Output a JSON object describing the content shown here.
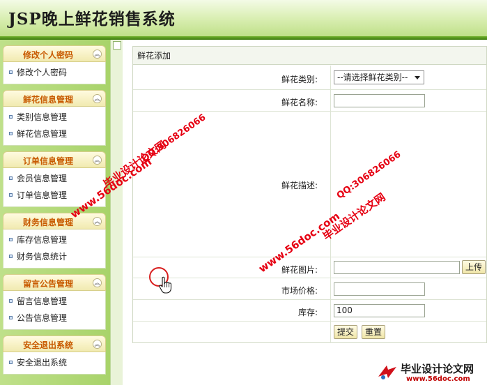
{
  "header": {
    "title": "JSP晚上鲜花销售系统"
  },
  "sidebar": {
    "groups": [
      {
        "title": "修改个人密码",
        "items": [
          "修改个人密码"
        ]
      },
      {
        "title": "鲜花信息管理",
        "items": [
          "类别信息管理",
          "鲜花信息管理"
        ]
      },
      {
        "title": "订单信息管理",
        "items": [
          "会员信息管理",
          "订单信息管理"
        ]
      },
      {
        "title": "财务信息管理",
        "items": [
          "库存信息管理",
          "财务信息统计"
        ]
      },
      {
        "title": "留言公告管理",
        "items": [
          "留言信息管理",
          "公告信息管理"
        ]
      },
      {
        "title": "安全退出系统",
        "items": [
          "安全退出系统"
        ]
      }
    ],
    "toggle_glyph": "︽"
  },
  "form": {
    "title": "鲜花添加",
    "category_label": "鲜花类别:",
    "category_selected": "--请选择鲜花类别--",
    "name_label": "鲜花名称:",
    "name_value": "",
    "desc_label": "鲜花描述:",
    "image_label": "鲜花图片:",
    "image_value": "",
    "upload_label": "上传",
    "price_label": "市场价格:",
    "price_value": "",
    "stock_label": "库存:",
    "stock_value": "100",
    "submit_label": "提交",
    "reset_label": "重置"
  },
  "watermarks": {
    "site": "www.56doc.com",
    "qq": "QQ:306826066",
    "brand": "毕业设计论文网"
  },
  "corner_logo": {
    "line1": "毕业设计论文网",
    "line2": "www.56doc.com"
  },
  "colors": {
    "accent_green": "#4f9a1c",
    "group_title": "#c85a00",
    "watermark_red": "#e60012"
  }
}
